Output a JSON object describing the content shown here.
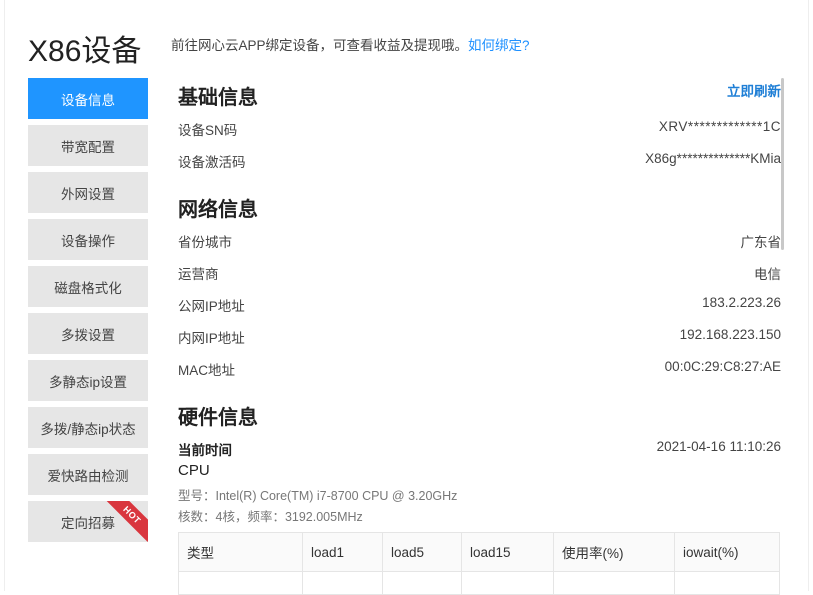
{
  "page": {
    "title": "X86设备",
    "hint_text": "前往网心云APP绑定设备，可查看收益及提现哦。",
    "hint_link": "如何绑定?"
  },
  "sidebar": {
    "items": [
      {
        "label": "设备信息"
      },
      {
        "label": "带宽配置"
      },
      {
        "label": "外网设置"
      },
      {
        "label": "设备操作"
      },
      {
        "label": "磁盘格式化"
      },
      {
        "label": "多拨设置"
      },
      {
        "label": "多静态ip设置"
      },
      {
        "label": "多拨/静态ip状态"
      },
      {
        "label": "爱快路由检测"
      },
      {
        "label": "定向招募",
        "badge": "HOT"
      }
    ]
  },
  "basic": {
    "title": "基础信息",
    "refresh": "立即刷新",
    "sn_label": "设备SN码",
    "sn_value": "XRV*************1C",
    "activation_label": "设备激活码",
    "activation_value": "X86g**************KMia"
  },
  "network": {
    "title": "网络信息",
    "province_label": "省份城市",
    "province_value": "广东省",
    "isp_label": "运营商",
    "isp_value": "电信",
    "public_ip_label": "公网IP地址",
    "public_ip_value": "183.2.223.26",
    "lan_ip_label": "内网IP地址",
    "lan_ip_value": "192.168.223.150",
    "mac_label": "MAC地址",
    "mac_value": "00:0C:29:C8:27:AE"
  },
  "hardware": {
    "title": "硬件信息",
    "time_label": "当前时间",
    "time_value": "2021-04-16 11:10:26",
    "cpu_title": "CPU",
    "cpu_model": "型号：Intel(R) Core(TM) i7-8700 CPU @ 3.20GHz",
    "cpu_cores": "核数：4核，频率：3192.005MHz",
    "table_headers": [
      "类型",
      "load1",
      "load5",
      "load15",
      "使用率(%)",
      "iowait(%)"
    ]
  }
}
